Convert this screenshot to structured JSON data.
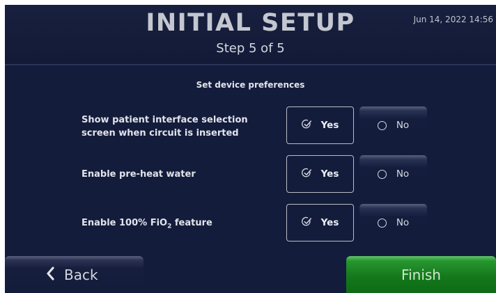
{
  "header": {
    "title": "INITIAL SETUP",
    "subtitle": "Step 5 of 5",
    "datetime": "Jun 14, 2022 14:56"
  },
  "section_title": "Set device preferences",
  "preferences": [
    {
      "label": "Show patient interface selection screen when circuit is inserted",
      "yes_label": "Yes",
      "no_label": "No",
      "selected": "Yes"
    },
    {
      "label": "Enable pre-heat water",
      "yes_label": "Yes",
      "no_label": "No",
      "selected": "Yes"
    },
    {
      "label_prefix": "Enable 100% FiO",
      "label_sub": "2",
      "label_suffix": " feature",
      "yes_label": "Yes",
      "no_label": "No",
      "selected": "Yes"
    }
  ],
  "footer": {
    "back_label": "Back",
    "finish_label": "Finish"
  },
  "icons": {
    "check": "check-circle-icon",
    "radio": "radio-unselected-icon",
    "back": "chevron-left-icon"
  },
  "colors": {
    "background": "#141c3c",
    "finish_green": "#14781b",
    "text": "#e2e4ea"
  }
}
